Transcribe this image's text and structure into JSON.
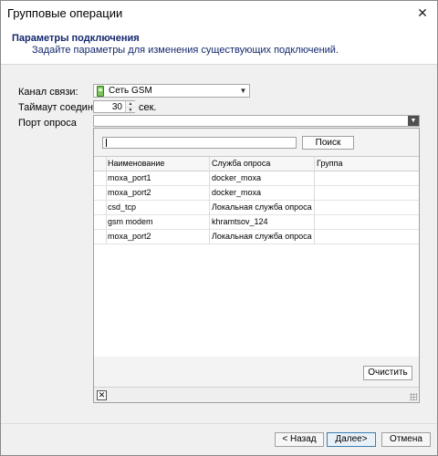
{
  "window": {
    "title": "Групповые операции"
  },
  "header": {
    "title": "Параметры подключения",
    "subtitle": "Задайте параметры для изменения существующих подключений."
  },
  "form": {
    "channel_label": "Канал связи:",
    "channel_value": "Сеть GSM",
    "timeout_label": "Таймаут соединения:",
    "timeout_value": "30",
    "timeout_unit": "сек.",
    "port_label": "Порт опроса",
    "port_value": ""
  },
  "popup": {
    "search_value": "",
    "search_button": "Поиск",
    "columns": [
      "Наименование",
      "Служба опроса",
      "Группа"
    ],
    "rows": [
      [
        "moxa_port1",
        "docker_moxa",
        ""
      ],
      [
        "moxa_port2",
        "docker_moxa",
        ""
      ],
      [
        "csd_tcp",
        "Локальная служба опроса",
        ""
      ],
      [
        "gsm modem",
        "khramtsov_124",
        ""
      ],
      [
        "moxa_port2",
        "Локальная служба опроса",
        ""
      ]
    ],
    "clear_button": "Очистить"
  },
  "footer": {
    "back_label": "< Назад",
    "next_label": "Далее>",
    "cancel_label": "Отмена"
  }
}
